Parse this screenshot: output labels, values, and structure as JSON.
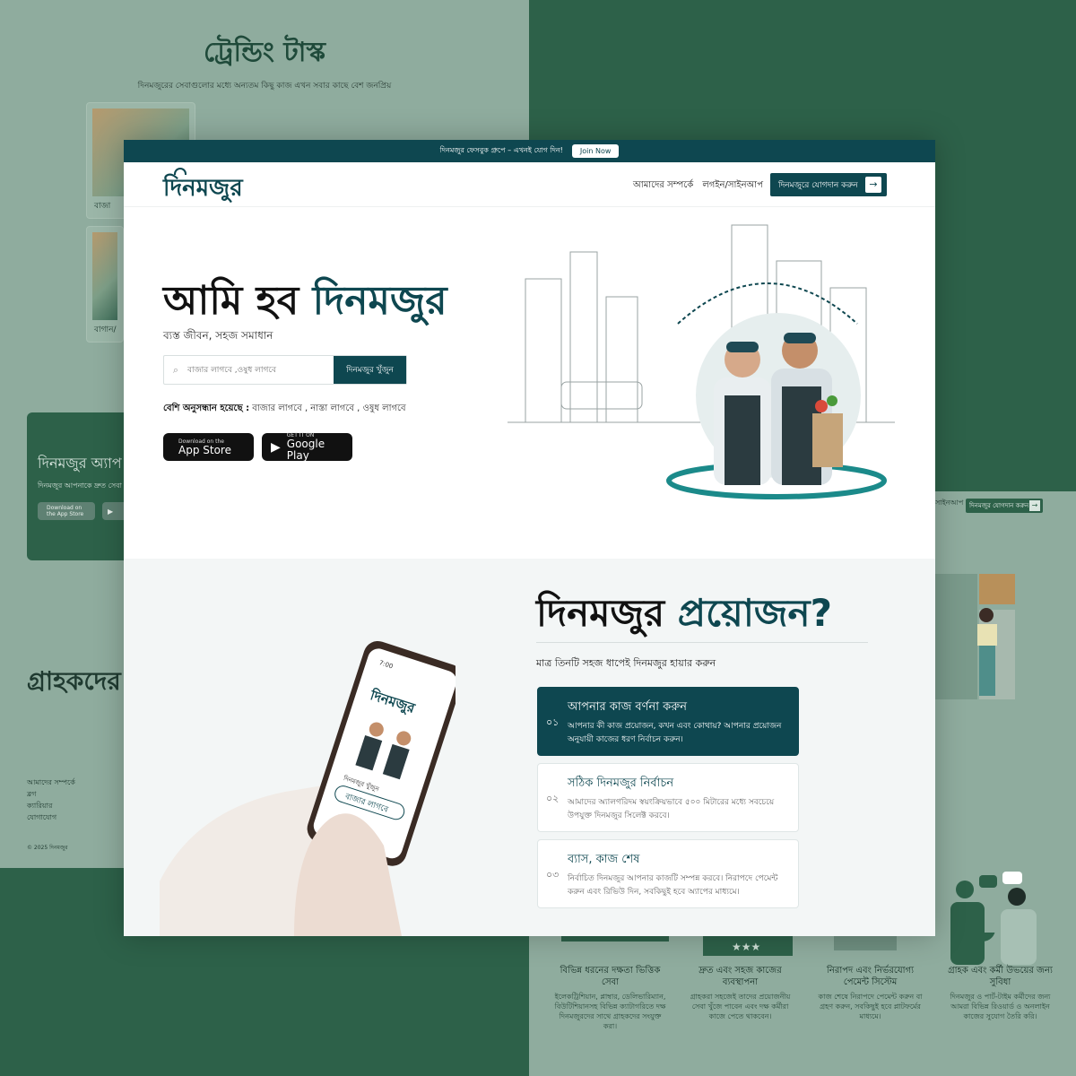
{
  "background": {
    "trending": {
      "title": "ট্রেন্ডিং টাস্ক",
      "subtitle": "দিনমজুরের সেবাগুলোর মধ্যে অন্যতম কিছু কাজ এখন সবার কাছে বেশ জনপ্রিয়",
      "cards": [
        "বাজা",
        "বাগান/"
      ]
    },
    "app_banner": {
      "title": "দিনমজুর অ্যাপ",
      "subtitle": "দিনমজুর আপনাকে দ্রুত সেবা",
      "store_label": "Download on the App Store"
    },
    "customers_title": "গ্রাহকদের",
    "footer": {
      "heading": "আমাদের সম্পর্কে",
      "links": [
        "ব্লগ",
        "ক্যারিয়ার",
        "যোগাযোগ"
      ],
      "copyright": "© 2025 দিনমজুর"
    },
    "right_nav": {
      "login": "সাইনআপ",
      "cta": "দিনমজুর যোগদান করুন"
    },
    "features": [
      {
        "title": "বিভিন্ন ধরনের দক্ষতা ভিত্তিক সেবা",
        "desc": "ইলেকট্রিশিয়ান, প্লাম্বার, ডেলিভারিম্যান, বিউটিশিয়ানসহ বিভিন্ন ক্যাটাগরিতে দক্ষ দিনমজুরদের সাথে গ্রাহকদের সংযুক্ত করা।"
      },
      {
        "title": "দ্রুত এবং সহজ কাজের ব্যবস্থাপনা",
        "desc": "গ্রাহকরা সহজেই তাদের প্রয়োজনীয় সেবা খুঁজে পাবেন এবং দক্ষ কর্মীরা কাজে পেতে থাকবেন।"
      },
      {
        "title": "নিরাপদ এবং নির্ভরযোগ্য পেমেন্ট সিস্টেম",
        "desc": "কাজ শেষে নিরাপদে পেমেন্ট করুন বা গ্রহণ করুন, সবকিছুই হবে প্লাটফর্মের মাধ্যমে।"
      },
      {
        "title": "গ্রাহক এবং কর্মী উভয়ের জন্য সুবিধা",
        "desc": "দিনমজুর ও পার্ট-টাইম কর্মীদের জন্য আমরা বিভিন্ন রিওয়ার্ড ও অনলাইন কাজের সুযোগ তৈরি করি।"
      }
    ]
  },
  "announcement": {
    "text": "দিনমজুর ফেসবুক গ্রুপে – এখনই যোগ দিন!",
    "join_label": "Join Now"
  },
  "header": {
    "logo": "দিনমজুর",
    "nav": [
      "আমাদের সম্পর্কে",
      "লগইন/সাইনআপ"
    ],
    "cta_label": "দিনমজুরে যোগদান করুন",
    "cta_arrow": "→"
  },
  "hero": {
    "title_part1": "আমি হব ",
    "title_part2": "দিনমজুর",
    "subtitle": "ব্যস্ত জীবন, সহজ সমাধান",
    "search_placeholder": "বাজার লাগবে ,ওষুধ লাগবে",
    "search_button": "দিনমজুর খুঁজুন",
    "popular_label": "বেশি অনুসন্ধান হয়েছে :",
    "popular_items": " বাজার লাগবে , নাস্তা লাগবে , ওষুধ লাগবে",
    "app_store": {
      "small": "Download on the",
      "big": "App Store"
    },
    "google_play": {
      "small": "GET IT ON",
      "big": "Google Play"
    }
  },
  "need": {
    "title_part1": "দিনমজুর ",
    "title_part2": "প্রয়োজন?",
    "subtitle": "মাত্র তিনটি সহজ ধাপেই দিনমজুর হায়ার করুন",
    "steps": [
      {
        "num": "০১",
        "title": "আপনার কাজ বর্ণনা করুন",
        "desc": "আপনার কী কাজ প্রয়োজন, কখন এবং কোথায়? আপনার প্রয়োজন অনুযায়ী কাজের ধরণ নির্বাচন করুন।"
      },
      {
        "num": "০২",
        "title": "সঠিক দিনমজুর নির্বাচন",
        "desc": "আমাদের অ্যালগরিদম স্বয়ংক্রিয়ভাবে ৫০০ মিটারের মধ্যে সবচেয়ে উপযুক্ত দিনমজুর সিলেক্ট করবে।"
      },
      {
        "num": "০৩",
        "title": "ব্যাস, কাজ শেষ",
        "desc": "নির্বাচিত দিনমজুর আপনার কাজটি সম্পন্ন করবে। নিরাপদে পেমেন্ট করুন এবং রিভিউ দিন, সবকিছুই হবে অ্যাপের মাধ্যমে।"
      }
    ],
    "phone": {
      "time": "7:00",
      "logo": "দিনমজুর",
      "search_label": "দিনমজুর খুঁজুন",
      "search_value": "বাজার লাগবে"
    }
  },
  "colors": {
    "brand": "#0e4750",
    "bg_green": "#2d6149",
    "bg_mint": "#8fac9e"
  }
}
